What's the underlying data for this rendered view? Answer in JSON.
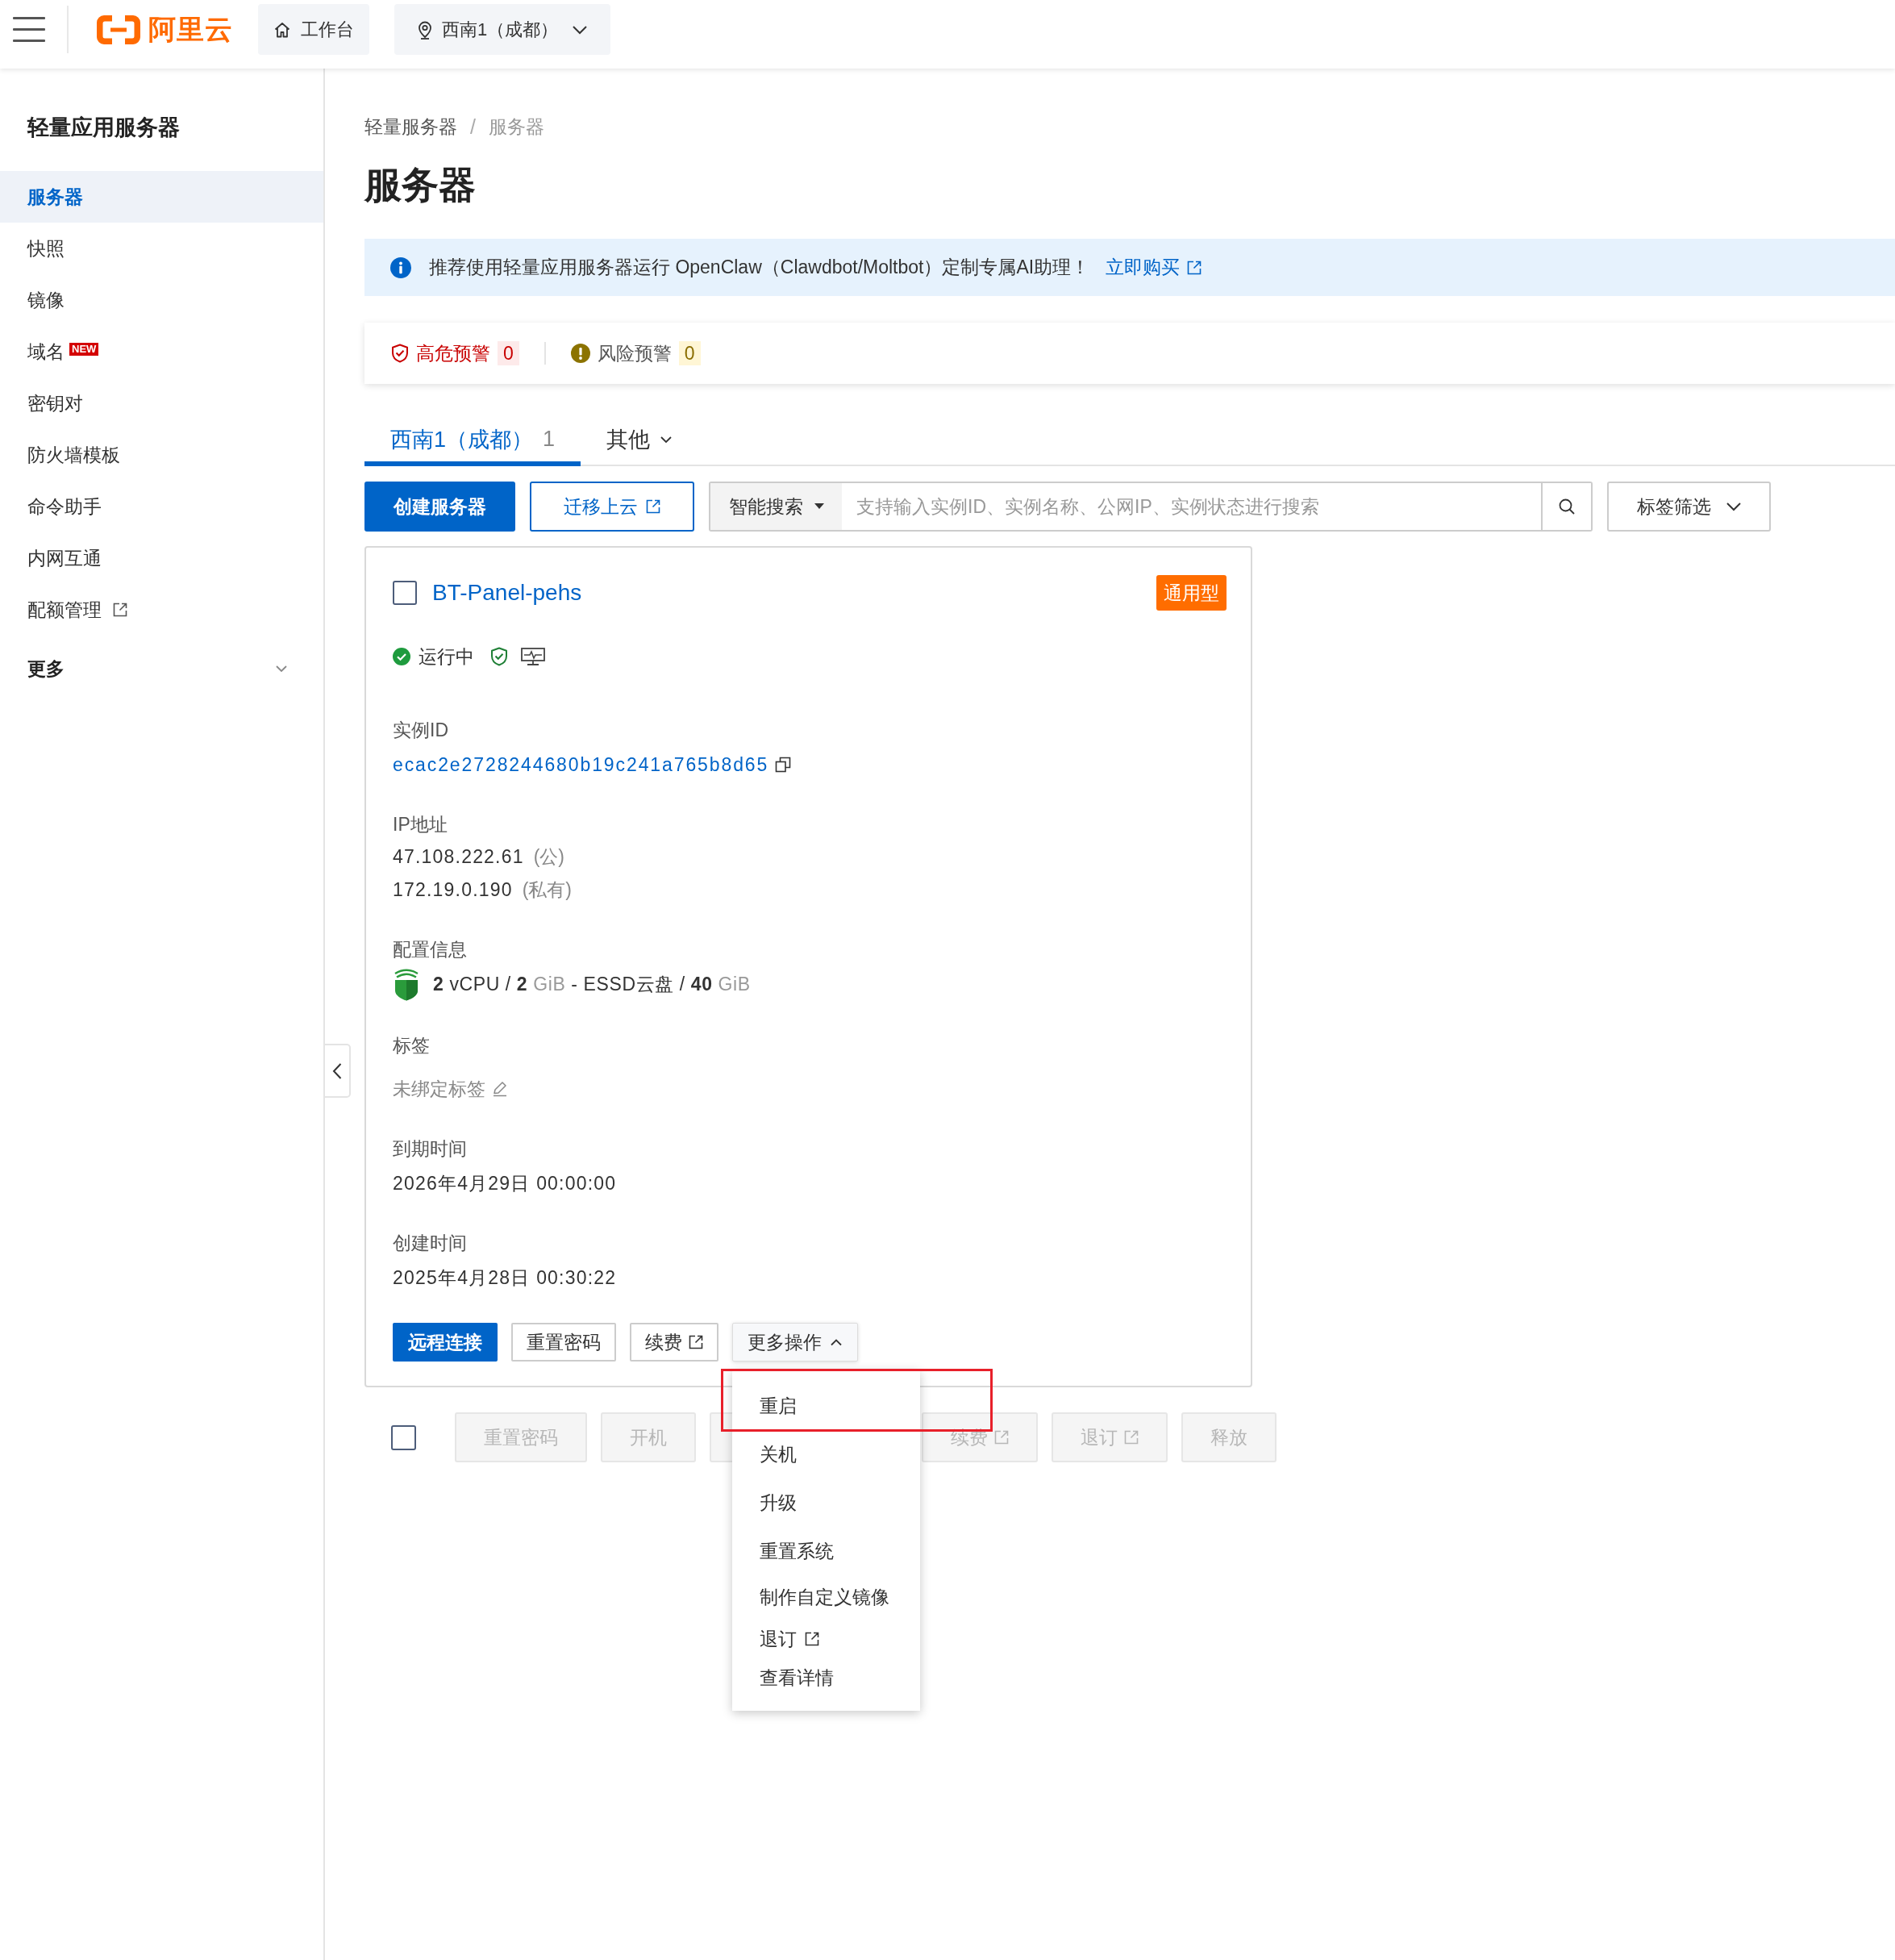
{
  "topbar": {
    "brand": "阿里云",
    "workbench": "工作台",
    "region": "西南1（成都）"
  },
  "sidebar": {
    "title": "轻量应用服务器",
    "items": [
      {
        "label": "服务器",
        "selected": true
      },
      {
        "label": "快照",
        "selected": false
      },
      {
        "label": "镜像",
        "selected": false
      },
      {
        "label": "域名",
        "selected": false,
        "badge": "NEW"
      },
      {
        "label": "密钥对",
        "selected": false
      },
      {
        "label": "防火墙模板",
        "selected": false
      },
      {
        "label": "命令助手",
        "selected": false
      },
      {
        "label": "内网互通",
        "selected": false
      },
      {
        "label": "配额管理",
        "selected": false,
        "external": true
      }
    ],
    "more": {
      "label": "更多",
      "expanded": false
    }
  },
  "breadcrumb": {
    "items": [
      "轻量服务器",
      "服务器"
    ],
    "separator": "/"
  },
  "page_title": "服务器",
  "notice": {
    "text": "推荐使用轻量应用服务器运行 OpenClaw（Clawdbot/Moltbot）定制专属AI助理！",
    "link": "立即购买"
  },
  "alerts": [
    {
      "kind": "high",
      "label": "高危预警",
      "count": "0"
    },
    {
      "kind": "risk",
      "label": "风险预警",
      "count": "0"
    }
  ],
  "tabs": [
    {
      "kind": "count",
      "label": "西南1（成都）",
      "count": "1",
      "selected": true
    },
    {
      "kind": "menu",
      "label": "其他",
      "selected": false
    }
  ],
  "toolbar": {
    "buttons": [
      {
        "kind": "primary",
        "label": "创建服务器"
      },
      {
        "kind": "outline",
        "label": "迁移上云",
        "external": true
      }
    ],
    "search": {
      "scope": "智能搜索",
      "placeholder": "支持输入实例ID、实例名称、公网IP、实例状态进行搜索"
    },
    "tag_filter": "标签筛选"
  },
  "server": {
    "checked": false,
    "name": "BT-Panel-pehs",
    "type_badge": "通用型",
    "status": "运行中",
    "fields": [
      {
        "kind": "id",
        "label": "实例ID",
        "value": "ecac2e2728244680b19c241a765b8d65"
      },
      {
        "kind": "ip",
        "label": "IP地址",
        "addresses": [
          {
            "address": "47.108.222.61",
            "note": "(公)"
          },
          {
            "address": "172.19.0.190",
            "note": "(私有)"
          }
        ]
      },
      {
        "kind": "spec",
        "label": "配置信息",
        "parts": [
          {
            "kind": "number",
            "text": "2"
          },
          {
            "kind": "text",
            "text": " vCPU / "
          },
          {
            "kind": "number",
            "text": "2"
          },
          {
            "kind": "unit",
            "text": " GiB"
          },
          {
            "kind": "text",
            "text": " - ESSD云盘 / "
          },
          {
            "kind": "number",
            "text": "40"
          },
          {
            "kind": "unit",
            "text": " GiB"
          }
        ]
      },
      {
        "kind": "tags",
        "label": "标签",
        "value": "未绑定标签"
      },
      {
        "kind": "text",
        "label": "到期时间",
        "value": "2026年4月29日 00:00:00"
      },
      {
        "kind": "text",
        "label": "创建时间",
        "value": "2025年4月28日 00:30:22"
      }
    ],
    "actions": [
      {
        "kind": "primary",
        "label": "远程连接"
      },
      {
        "kind": "default",
        "label": "重置密码"
      },
      {
        "kind": "default",
        "label": "续费",
        "external": true
      }
    ],
    "more_actions": {
      "label": "更多操作",
      "expanded": true,
      "items": [
        {
          "label": "重启",
          "highlighted": true
        },
        {
          "label": "关机",
          "highlighted": false
        },
        {
          "label": "升级",
          "highlighted": false
        },
        {
          "label": "重置系统",
          "highlighted": false
        },
        {
          "label": "制作自定义镜像",
          "highlighted": false
        },
        {
          "label": "退订",
          "highlighted": false,
          "external": true
        },
        {
          "label": "查看详情",
          "highlighted": false
        }
      ]
    }
  },
  "batch": {
    "checked": false,
    "buttons": [
      {
        "kind": "text",
        "label": "重置密码",
        "disabled": true
      },
      {
        "kind": "text",
        "label": "开机",
        "disabled": true
      },
      {
        "kind": "covered",
        "disabled": true
      },
      {
        "kind": "text",
        "label": "续费",
        "disabled": true,
        "external": true
      },
      {
        "kind": "text",
        "label": "退订",
        "disabled": true,
        "external": true
      },
      {
        "kind": "text",
        "label": "释放",
        "disabled": true
      }
    ]
  }
}
